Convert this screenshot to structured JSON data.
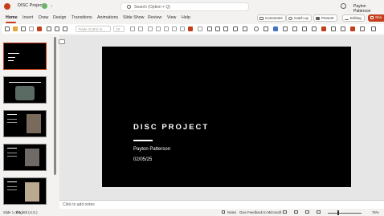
{
  "titlebar": {
    "doc_title": "DISC Project",
    "search_placeholder": "Search (Option + Q)",
    "user_name": "Payton Patterson"
  },
  "tabs": [
    {
      "label": "Home",
      "active": true
    },
    {
      "label": "Insert"
    },
    {
      "label": "Draw"
    },
    {
      "label": "Design"
    },
    {
      "label": "Transitions"
    },
    {
      "label": "Animations"
    },
    {
      "label": "Slide Show"
    },
    {
      "label": "Review"
    },
    {
      "label": "View"
    },
    {
      "label": "Help"
    }
  ],
  "tab_buttons": {
    "comments": "Comments",
    "catchup": "Catch up",
    "present": "Present",
    "editing": "Editing",
    "share": "Sha"
  },
  "toolbar": {
    "font": "Trade Gothic N...",
    "size": "18"
  },
  "thumbnails": [
    {
      "title": "DISC PROJECT",
      "selected": true
    },
    {
      "title": "CREATIVE PROBLEM DEF"
    },
    {
      "title": "WALTER WHITE"
    },
    {
      "title": "JESSE PINKMAN"
    },
    {
      "title": "SKYLER WHITE"
    }
  ],
  "slide": {
    "title": "DISC PROJECT",
    "name": "Payton Patterson",
    "date": "02/05/25"
  },
  "notes": {
    "placeholder": "Click to add notes"
  },
  "statusbar": {
    "slide_count": "Slide 1 of 6",
    "language": "English (U.S.)",
    "notes": "Notes",
    "feedback": "Give Feedback to Microsoft",
    "zoom": "76%"
  },
  "colors": {
    "accent": "#c43e1c",
    "slide_bg": "#000000",
    "slide_text": "#ffffff"
  }
}
